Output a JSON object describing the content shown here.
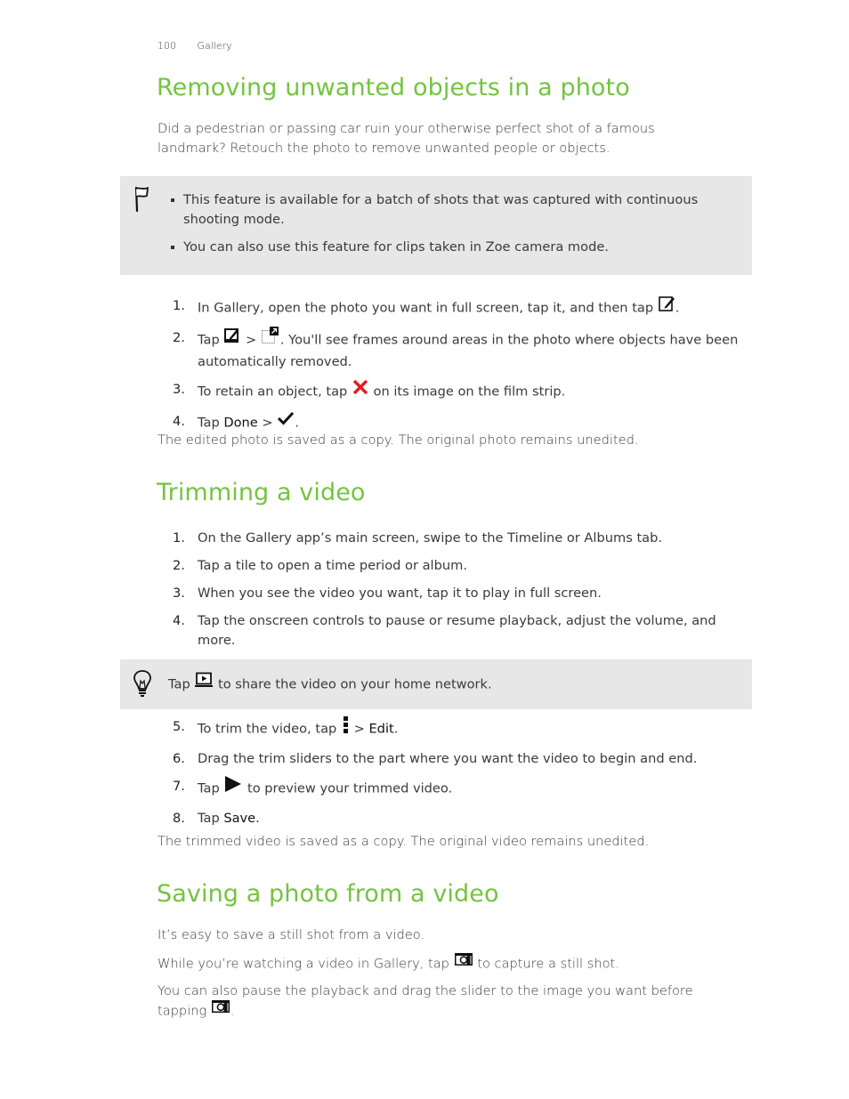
{
  "running_head": {
    "page_number": "100",
    "section": "Gallery"
  },
  "sections": [
    {
      "title": "Removing unwanted objects in a photo",
      "intro": "Did a pedestrian or passing car ruin your otherwise perfect shot of a famous landmark? Retouch the photo to remove unwanted people or objects.",
      "note": {
        "icon": "flag-icon",
        "items": [
          "This feature is available for a batch of shots that was captured with continuous shooting mode.",
          "You can also use this feature for clips taken in Zoe camera mode."
        ]
      },
      "steps": [
        {
          "num": "1.",
          "a": "In Gallery, open the photo you want in full screen, tap it, and then tap ",
          "icon1": "edit-icon",
          "b": "."
        },
        {
          "num": "2.",
          "a": "Tap ",
          "icon1": "edit-icon",
          "sep": " > ",
          "icon2": "retouch-object-removal-icon",
          "b": ". You'll see frames around areas in the photo where objects have been automatically removed."
        },
        {
          "num": "3.",
          "a": "To retain an object, tap ",
          "icon1": "red-x-icon",
          "b": " on its image on the film strip."
        },
        {
          "num": "4.",
          "a": "Tap ",
          "term": "Done",
          "sep": " > ",
          "icon1": "checkmark-icon",
          "b": "."
        }
      ],
      "outro": "The edited photo is saved as a copy. The original photo remains unedited."
    },
    {
      "title": "Trimming a video",
      "steps": [
        {
          "num": "1.",
          "text": "On the Gallery app’s main screen, swipe to the Timeline or Albums tab."
        },
        {
          "num": "2.",
          "text": "Tap a tile to open a time period or album."
        },
        {
          "num": "3.",
          "text": "When you see the video you want, tap it to play in full screen."
        },
        {
          "num": "4.",
          "text": "Tap the onscreen controls to pause or resume playback, adjust the volume, and more."
        }
      ],
      "tip": {
        "icon": "lightbulb-icon",
        "a": "Tap ",
        "icon1": "media-share-icon",
        "b": " to share the video on your home network."
      },
      "steps2": [
        {
          "num": "5.",
          "a": "To trim the video, tap ",
          "icon1": "overflow-menu-icon",
          "sep": " > ",
          "term": "Edit",
          "b": "."
        },
        {
          "num": "6.",
          "text": "Drag the trim sliders to the part where you want the video to begin and end."
        },
        {
          "num": "7.",
          "a": "Tap ",
          "icon1": "play-icon",
          "b": " to preview your trimmed video."
        },
        {
          "num": "8.",
          "a": "Tap ",
          "term": "Save",
          "b": "."
        }
      ],
      "outro": "The trimmed video is saved as a copy. The original video remains unedited."
    },
    {
      "title": "Saving a photo from a video",
      "p1": "It’s easy to save a still shot from a video.",
      "p2a": "While you’re watching a video in Gallery, tap ",
      "p2b": " to capture a still shot.",
      "p3a": "You can also pause the playback and drag the slider to the image you want before tapping ",
      "p3b": "."
    }
  ],
  "colors": {
    "heading": "#74c43f",
    "note_bg": "#e7e7e7",
    "x_icon": "#e02020"
  }
}
